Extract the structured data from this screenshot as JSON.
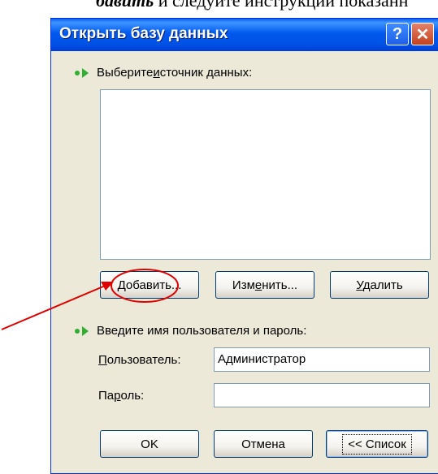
{
  "doc_fragment": {
    "italic_part": "бавить",
    "rest": " и следуйте инструкции показанн"
  },
  "window": {
    "title": "Открыть базу данных",
    "help_glyph": "?",
    "close_glyph": "✕"
  },
  "source_section": {
    "label_before": "Выберите ",
    "label_accel": "и",
    "label_after": "сточник данных:",
    "items": []
  },
  "source_buttons": {
    "add_accel": "Д",
    "add_rest": "обавить...",
    "edit_before": "Изм",
    "edit_accel": "е",
    "edit_after": "нить...",
    "delete_accel": "У",
    "delete_rest": "далить"
  },
  "credentials": {
    "label": "Введите имя пользователя и пароль:",
    "user_accel": "П",
    "user_rest": "ользователь:",
    "user_value": "Администратор",
    "password_before": "Па",
    "password_accel": "р",
    "password_after": "оль:",
    "password_value": ""
  },
  "footer_buttons": {
    "ok": "OK",
    "cancel": "Отмена",
    "list": "<< Список"
  },
  "colors": {
    "titlebar": "#0058ee",
    "arrow_icon": "#2fae2f",
    "annotation": "#e00000"
  }
}
